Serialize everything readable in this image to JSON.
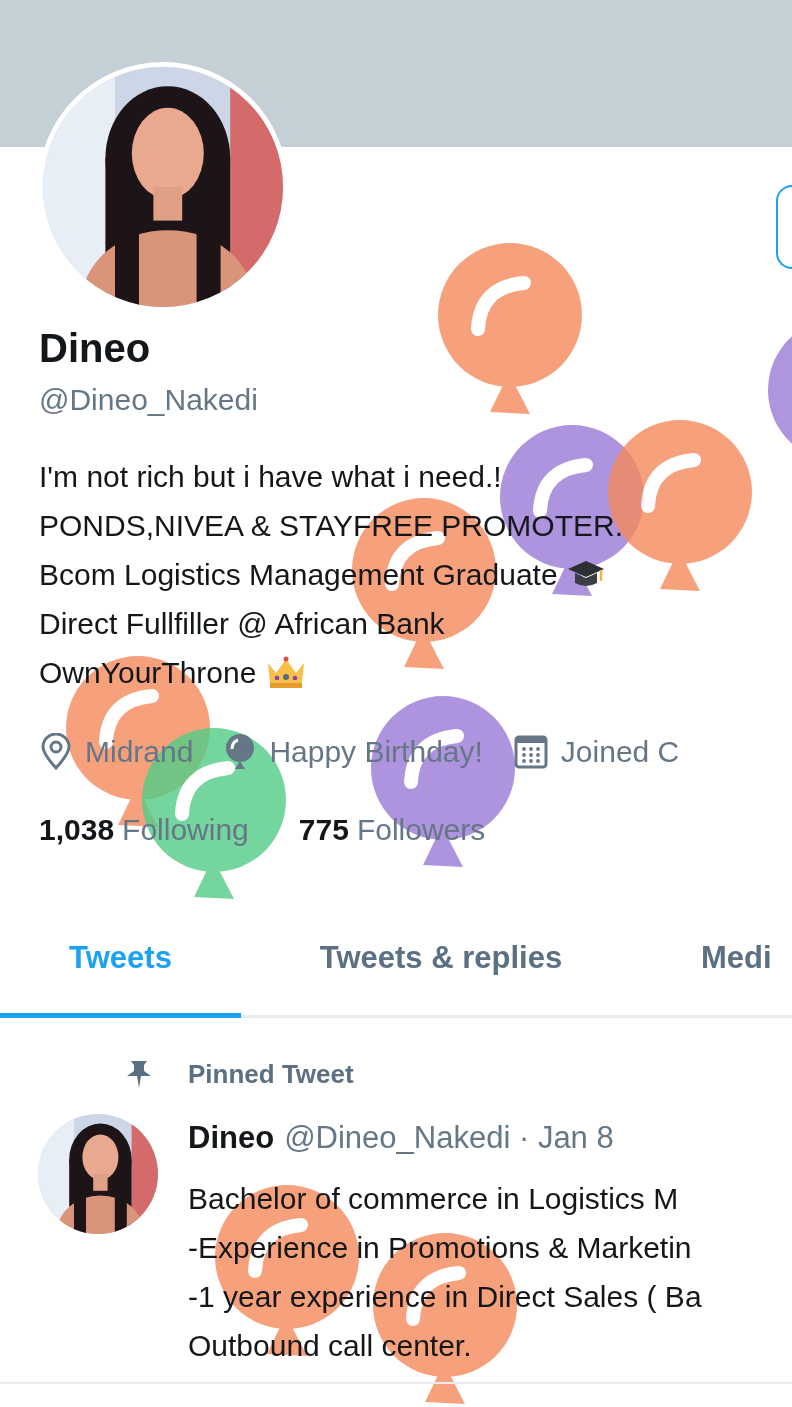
{
  "profile": {
    "name": "Dineo",
    "handle": "@Dineo_Nakedi",
    "bio": [
      "I'm not rich but i have what i need.!",
      "PONDS,NIVEA & STAYFREE PROMOTER.",
      "Bcom Logistics Management Graduate",
      "Direct Fullfiller @ African Bank",
      "OwnYourThrone"
    ],
    "meta": [
      {
        "kind": "location",
        "text": "Midrand"
      },
      {
        "kind": "birthday",
        "text": "Happy Birthday!"
      },
      {
        "kind": "joined",
        "text": "Joined C"
      }
    ],
    "stats": [
      {
        "count": "1,038",
        "label": "Following"
      },
      {
        "count": "775",
        "label": "Followers"
      }
    ]
  },
  "tabs": [
    {
      "label": "Tweets",
      "selected": true
    },
    {
      "label": "Tweets & replies",
      "selected": false
    },
    {
      "label": "Medi",
      "selected": false
    }
  ],
  "pinned_tweet": {
    "label": "Pinned Tweet",
    "name": "Dineo",
    "meta": "@Dineo_Nakedi · Jan 8",
    "lines": [
      "Bachelor of commerce in Logistics M",
      "-Experience in Promotions & Marketin",
      "-1 year experience in Direct Sales ( Ba",
      "Outbound call center."
    ]
  }
}
